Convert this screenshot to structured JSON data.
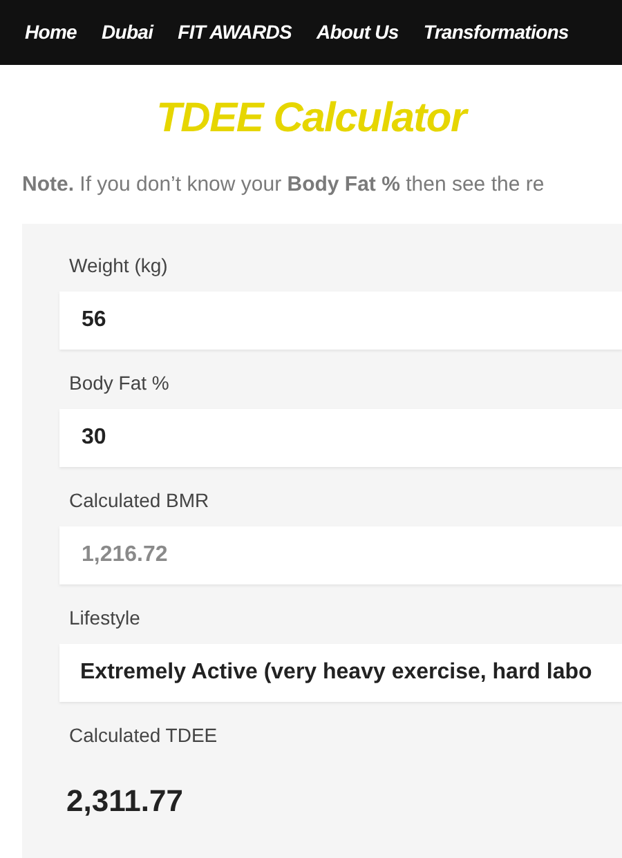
{
  "nav": [
    {
      "label": "Home"
    },
    {
      "label": "Dubai"
    },
    {
      "label": "FIT AWARDS"
    },
    {
      "label": "About Us"
    },
    {
      "label": "Transformations"
    }
  ],
  "title": "TDEE Calculator",
  "note": "**Note.** If you don’t know your **Body Fat %** then see the re",
  "fields": [
    {
      "kind": "input",
      "label": "Weight (kg)",
      "value": "56",
      "disabled": false
    },
    {
      "kind": "input",
      "label": "Body Fat %",
      "value": "30",
      "disabled": false
    },
    {
      "kind": "input",
      "label": "Calculated BMR",
      "value": "1,216.72",
      "disabled": true
    },
    {
      "kind": "select",
      "label": "Lifestyle",
      "value": "Extremely Active (very heavy exercise, hard labo"
    },
    {
      "kind": "result",
      "label": "Calculated TDEE",
      "value": "2,311.77"
    }
  ]
}
